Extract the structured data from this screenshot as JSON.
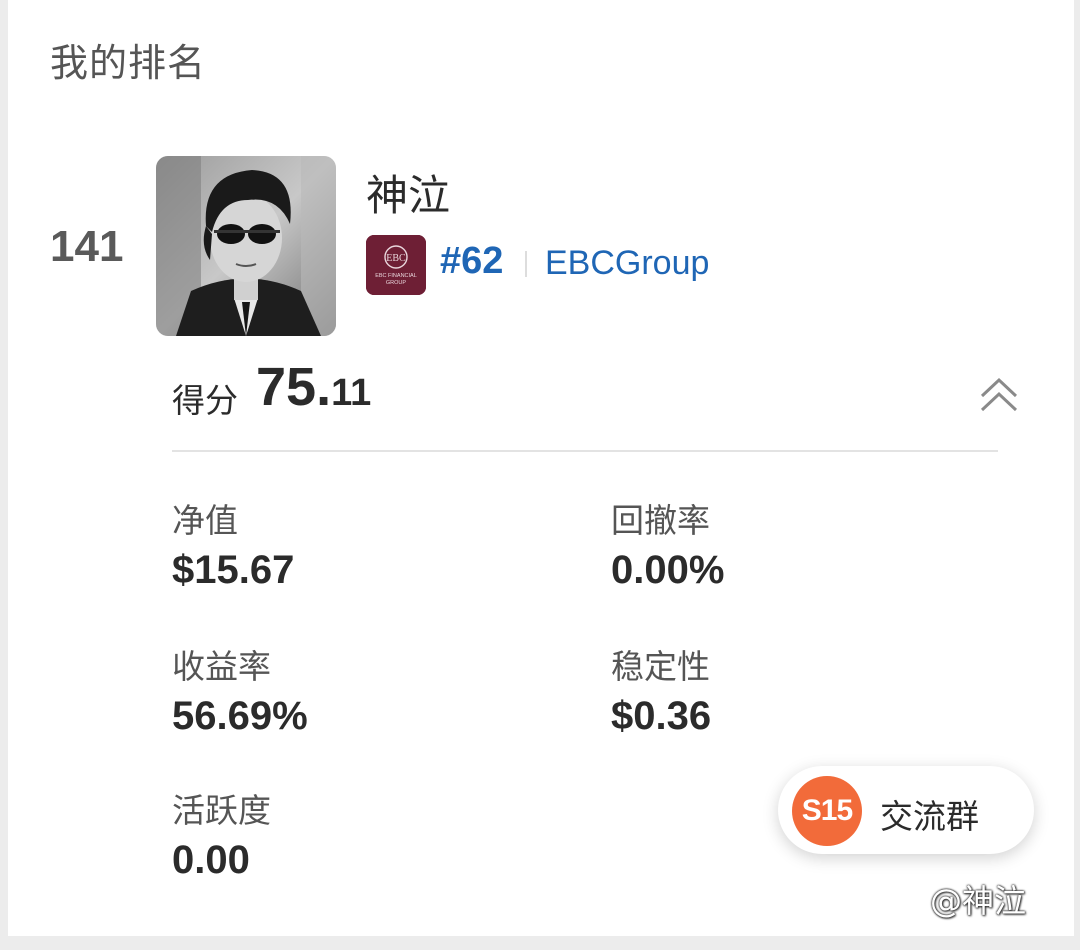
{
  "section_title": "我的排名",
  "rank": "141",
  "user": {
    "name": "神泣"
  },
  "broker": {
    "logo_name": "ebc-financial-group-logo",
    "logo_text": "EBC FINANCIAL GROUP",
    "rank": "#62",
    "name": "EBCGroup"
  },
  "score": {
    "label": "得分",
    "integer": "75.",
    "decimal": "11"
  },
  "metrics": {
    "net_value": {
      "label": "净值",
      "value": "$15.67"
    },
    "drawdown": {
      "label": "回撤率",
      "value": "0.00%"
    },
    "return_rate": {
      "label": "收益率",
      "value": "56.69%"
    },
    "stability": {
      "label": "稳定性",
      "value": "$0.36"
    },
    "activity": {
      "label": "活跃度",
      "value": "0.00"
    }
  },
  "group_chat": {
    "badge": "S15",
    "label": "交流群"
  },
  "watermark": "@神泣",
  "colors": {
    "accent_blue": "#1f66b5",
    "broker_brand": "#6e1f35",
    "chip_orange": "#f26b3a"
  }
}
